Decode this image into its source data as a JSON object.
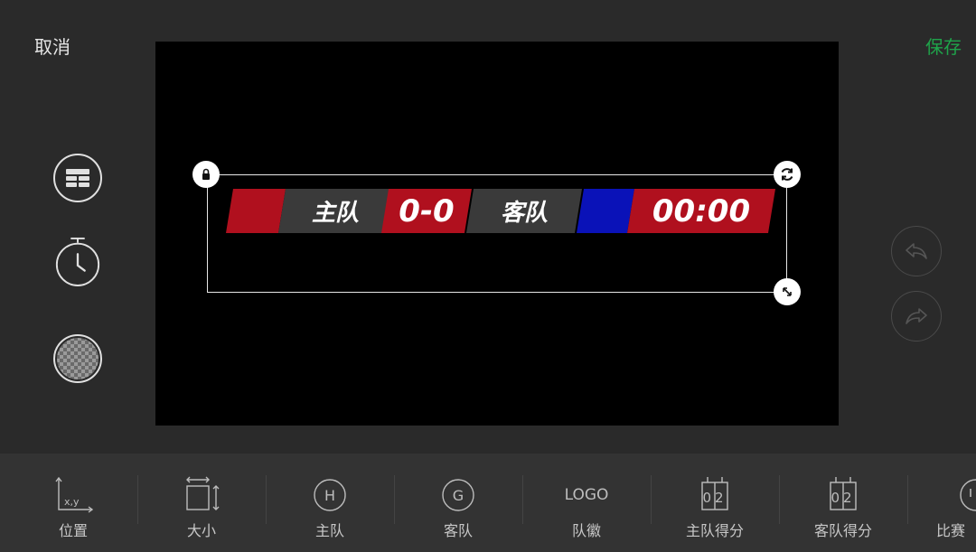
{
  "topbar": {
    "cancel_label": "取消",
    "save_label": "保存"
  },
  "scoreboard": {
    "home_name": "主队",
    "score": "0-0",
    "away_name": "客队",
    "timer": "00:00",
    "colors": {
      "home": "#b0101e",
      "away": "#0a12b8",
      "panel": "#3a3a3a"
    }
  },
  "left_tools": [
    "layout-icon",
    "stopwatch-icon",
    "background-pattern-icon"
  ],
  "history": [
    "undo-icon",
    "redo-icon"
  ],
  "bottom_toolbar": {
    "items": [
      {
        "label": "位置",
        "icon": "position-icon",
        "icon_text": "x,y"
      },
      {
        "label": "大小",
        "icon": "size-icon",
        "icon_text": ""
      },
      {
        "label": "主队",
        "icon": "home-team-icon",
        "icon_text": "H"
      },
      {
        "label": "客队",
        "icon": "away-team-icon",
        "icon_text": "G"
      },
      {
        "label": "队徽",
        "icon": "logo-icon",
        "icon_text": "LOGO"
      },
      {
        "label": "主队得分",
        "icon": "home-score-icon",
        "icon_text": "02"
      },
      {
        "label": "客队得分",
        "icon": "away-score-icon",
        "icon_text": "02"
      },
      {
        "label": "比赛",
        "icon": "match-icon",
        "icon_text": ""
      }
    ]
  }
}
